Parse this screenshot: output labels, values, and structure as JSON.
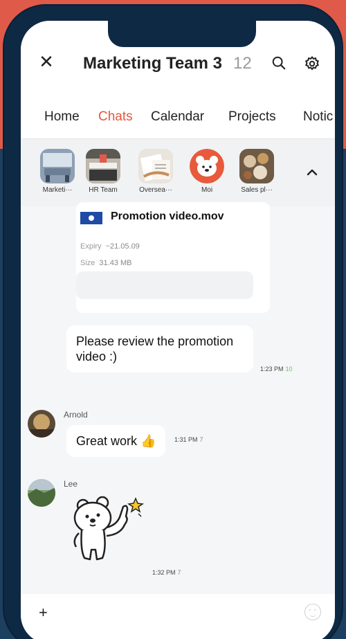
{
  "header": {
    "title": "Marketing Team 3",
    "member_count": "12"
  },
  "tabs": [
    "Home",
    "Chats",
    "Calendar",
    "Projects",
    "Notic"
  ],
  "active_tab": "Chats",
  "chatrooms": [
    {
      "label": "Marketi···",
      "icon": "meeting-room-thumb"
    },
    {
      "label": "HR Team",
      "icon": "office-thumb"
    },
    {
      "label": "Oversea···",
      "icon": "documents-thumb"
    },
    {
      "label": "Moi",
      "icon": "bear-mascot-thumb"
    },
    {
      "label": "Sales pl···",
      "icon": "food-table-thumb"
    }
  ],
  "file_message": {
    "filename": "Promotion video.mov",
    "expiry_label": "Expiry",
    "expiry_value": "~21.05.09",
    "size_label": "Size",
    "size_value": "31.43 MB"
  },
  "messages": [
    {
      "text": "Please review the promotion video :)",
      "time": "1:23 PM",
      "unread": "10"
    },
    {
      "sender": "Arnold",
      "text": "Great work",
      "emoji": "👍",
      "time": "1:31 PM",
      "unread": "7"
    },
    {
      "sender": "Lee",
      "sticker": "bear-thumbs-up-sticker",
      "time": "1:32 PM",
      "unread": "7"
    }
  ],
  "input": {
    "plus": "+"
  },
  "colors": {
    "accent": "#e2573f",
    "unread_green": "#6fb96b",
    "background_red": "#e05a4a",
    "background_navy": "#1d3f60"
  }
}
